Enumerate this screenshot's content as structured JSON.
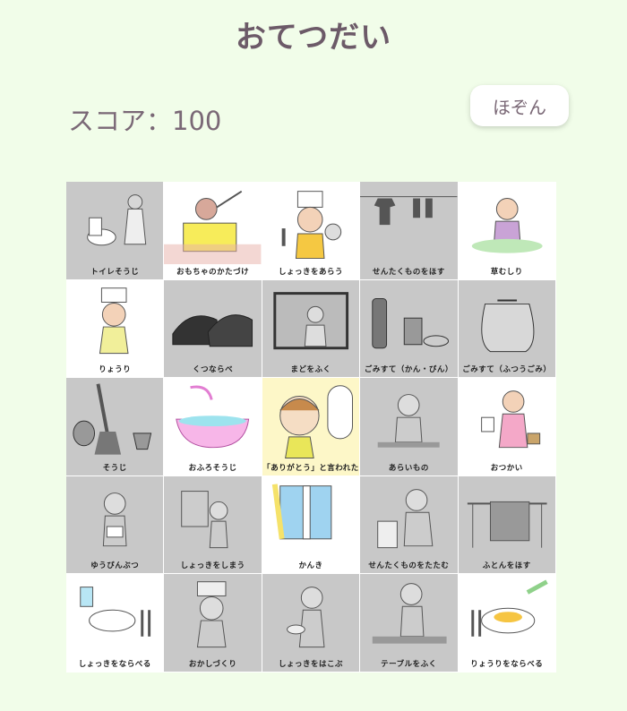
{
  "header": {
    "title": "おてつだい"
  },
  "score": {
    "label": "スコア：100"
  },
  "save_button": {
    "label": "ほぞん"
  },
  "cells": [
    {
      "label": "トイレそうじ",
      "state": "done",
      "icon": "toilet-cleaning-icon"
    },
    {
      "label": "おもちゃのかたづけ",
      "state": "todo",
      "icon": "toy-box-icon"
    },
    {
      "label": "しょっきをあらう",
      "state": "todo",
      "icon": "dish-washing-icon"
    },
    {
      "label": "せんたくものをほす",
      "state": "done",
      "icon": "laundry-hanging-icon"
    },
    {
      "label": "草むしり",
      "state": "todo",
      "icon": "weeding-icon"
    },
    {
      "label": "りょうり",
      "state": "todo",
      "icon": "cooking-icon"
    },
    {
      "label": "くつならべ",
      "state": "done",
      "icon": "shoes-icon"
    },
    {
      "label": "まどをふく",
      "state": "done",
      "icon": "window-wiping-icon"
    },
    {
      "label": "ごみすて（かん・びん）",
      "state": "done",
      "icon": "cans-bottles-icon"
    },
    {
      "label": "ごみすて（ふつうごみ）",
      "state": "done",
      "icon": "garbage-bag-icon"
    },
    {
      "label": "そうじ",
      "state": "done",
      "icon": "broom-icon"
    },
    {
      "label": "おふろそうじ",
      "state": "todo",
      "icon": "bathtub-icon"
    },
    {
      "label": "「ありがとう」と言われた",
      "state": "special",
      "icon": "thank-you-icon"
    },
    {
      "label": "あらいもの",
      "state": "done",
      "icon": "washing-up-icon"
    },
    {
      "label": "おつかい",
      "state": "todo",
      "icon": "errand-icon"
    },
    {
      "label": "ゆうびんぶつ",
      "state": "done",
      "icon": "mail-icon"
    },
    {
      "label": "しょっきをしまう",
      "state": "done",
      "icon": "dishes-away-icon"
    },
    {
      "label": "かんき",
      "state": "todo",
      "icon": "ventilation-icon"
    },
    {
      "label": "せんたくものをたたむ",
      "state": "done",
      "icon": "laundry-folding-icon"
    },
    {
      "label": "ふとんをほす",
      "state": "done",
      "icon": "futon-icon"
    },
    {
      "label": "しょっきをならべる",
      "state": "todo",
      "icon": "table-setting-icon"
    },
    {
      "label": "おかしづくり",
      "state": "done",
      "icon": "baking-icon"
    },
    {
      "label": "しょっきをはこぶ",
      "state": "done",
      "icon": "carrying-dishes-icon"
    },
    {
      "label": "テーブルをふく",
      "state": "done",
      "icon": "table-wiping-icon"
    },
    {
      "label": "りょうりをならべる",
      "state": "todo",
      "icon": "serving-food-icon"
    }
  ]
}
